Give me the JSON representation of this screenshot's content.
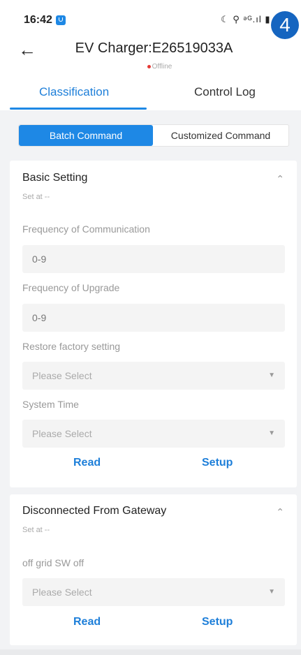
{
  "status_bar": {
    "time": "16:42",
    "icons_text": "☾ ⚲ ᵊᴳ.ıl ▮"
  },
  "step_badge": "4",
  "header": {
    "title": "EV Charger:E26519033A",
    "status": "Offline",
    "status_color": "#e53935",
    "back_icon": "back-arrow-icon"
  },
  "tabs": [
    {
      "label": "Classification",
      "active": true
    },
    {
      "label": "Control Log",
      "active": false
    }
  ],
  "segments": [
    {
      "label": "Batch Command",
      "active": true
    },
    {
      "label": "Customized Command",
      "active": false
    }
  ],
  "cards": {
    "basic": {
      "title": "Basic Setting",
      "set_at": "Set at --",
      "fields": [
        {
          "label": "Frequency of Communication",
          "value": "0-9",
          "type": "input"
        },
        {
          "label": "Frequency of Upgrade",
          "value": "0-9",
          "type": "input"
        },
        {
          "label": "Restore factory setting",
          "value": "Please Select",
          "type": "select"
        },
        {
          "label": "System Time",
          "value": "Please Select",
          "type": "select"
        }
      ],
      "read_label": "Read",
      "setup_label": "Setup"
    },
    "gateway": {
      "title": "Disconnected From Gateway",
      "set_at": "Set at --",
      "fields": [
        {
          "label": "off grid SW off",
          "value": "Please Select",
          "type": "select"
        }
      ],
      "read_label": "Read",
      "setup_label": "Setup"
    }
  },
  "colors": {
    "accent": "#1e88e5",
    "offline": "#e53935",
    "background": "#f2f3f5"
  }
}
